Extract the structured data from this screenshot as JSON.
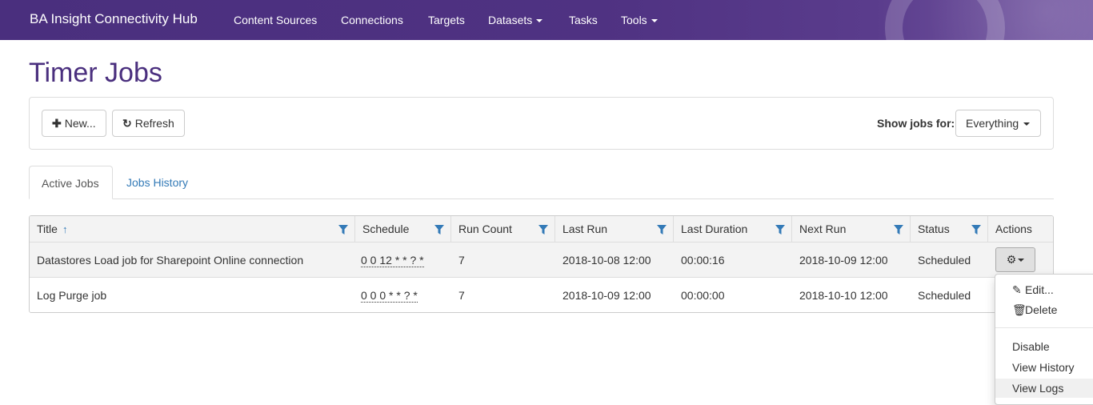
{
  "navbar": {
    "brand": "BA Insight Connectivity Hub",
    "items": [
      {
        "label": "Content Sources"
      },
      {
        "label": "Connections"
      },
      {
        "label": "Targets"
      },
      {
        "label": "Datasets"
      },
      {
        "label": "Tasks"
      },
      {
        "label": "Tools"
      }
    ]
  },
  "page": {
    "title": "Timer Jobs"
  },
  "toolbar": {
    "new_label": "New...",
    "refresh_label": "Refresh",
    "show_jobs_label": "Show jobs for:",
    "show_jobs_value": "Everything"
  },
  "tabs": [
    {
      "label": "Active Jobs",
      "active": true
    },
    {
      "label": "Jobs History",
      "active": false
    }
  ],
  "grid": {
    "columns": [
      "Title",
      "Schedule",
      "Run Count",
      "Last Run",
      "Last Duration",
      "Next Run",
      "Status",
      "Actions"
    ],
    "sort_icon": "↑",
    "rows": [
      {
        "title": "Datastores Load job for Sharepoint Online connection",
        "schedule": "0 0 12 * * ? *",
        "run_count": "7",
        "last_run": "2018-10-08 12:00",
        "last_duration": "00:00:16",
        "next_run": "2018-10-09 12:00",
        "status": "Scheduled"
      },
      {
        "title": "Log Purge job",
        "schedule": "0 0 0 * * ? *",
        "run_count": "7",
        "last_run": "2018-10-09 12:00",
        "last_duration": "00:00:00",
        "next_run": "2018-10-10 12:00",
        "status": "Scheduled"
      }
    ]
  },
  "actions_menu": {
    "items": [
      {
        "label": "Edit...",
        "icon": "pencil-icon"
      },
      {
        "label": "Delete",
        "icon": "trash-icon"
      },
      {
        "label": "Disable"
      },
      {
        "label": "View History"
      },
      {
        "label": "View Logs"
      }
    ]
  },
  "colors": {
    "brand": "#4a2f7e",
    "link": "#337ab7",
    "filter": "#337ab7"
  }
}
